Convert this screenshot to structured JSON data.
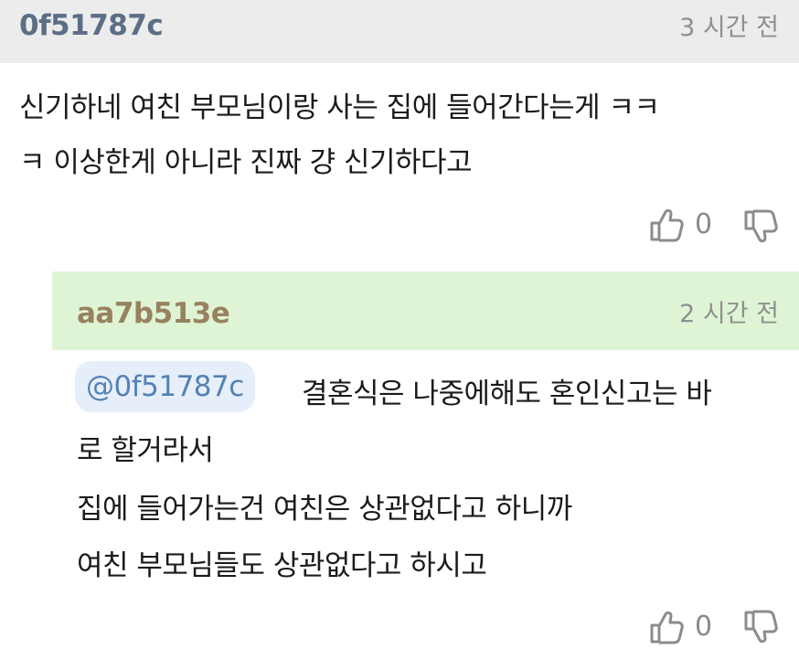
{
  "comment": {
    "author": "0f51787c",
    "time": "3 시간 전",
    "lines": [
      "신기하네 여친 부모님이랑 사는 집에 들어간다는게 ㅋㅋ",
      "ㅋ 이상한게 아니라 진짜 걍 신기하다고"
    ],
    "likes": "0",
    "icons": {
      "like": "thumbs-up-icon",
      "dislike": "thumbs-down-icon"
    }
  },
  "reply": {
    "author": "aa7b513e",
    "time": "2 시간 전",
    "mention": "@0f51787c",
    "lines": [
      "결혼식은 나중에해도 혼인신고는 바",
      "로 할거라서",
      "집에 들어가는건 여친은 상관없다고 하니까",
      "여친 부모님들도 상관없다고 하시고"
    ],
    "likes": "0"
  },
  "colors": {
    "comment_header_bg": "#ececec",
    "reply_header_bg": "#dff4d5",
    "comment_author": "#5b6e86",
    "reply_author": "#98825e",
    "mention_text": "#5581b5",
    "mention_bg": "#e6eff9",
    "meta_text": "#8f8f8f"
  }
}
